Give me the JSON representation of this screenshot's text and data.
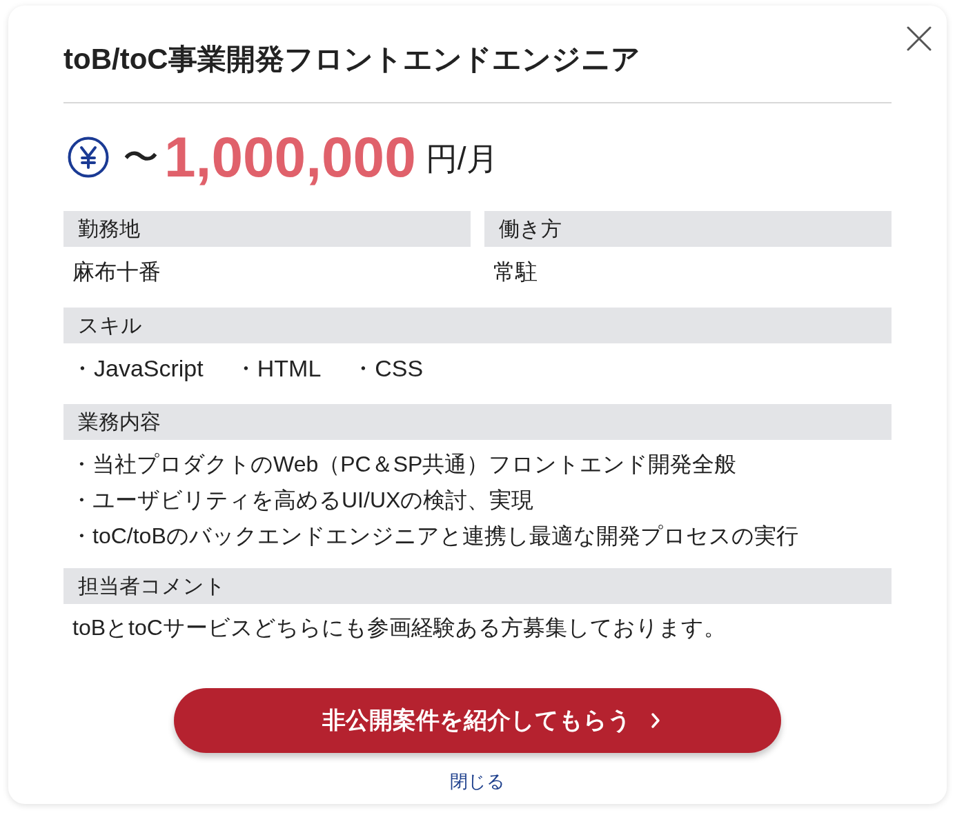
{
  "dialog": {
    "title": "toB/toC事業開発フロントエンドエンジニア"
  },
  "salary": {
    "prefix": "〜",
    "amount": "1,000,000",
    "unit": "円/月"
  },
  "info_grid": [
    {
      "heading": "勤務地",
      "value": "麻布十番"
    },
    {
      "heading": "働き方",
      "value": "常駐"
    }
  ],
  "skills": {
    "heading": "スキル",
    "items": [
      "・JavaScript",
      "・HTML",
      "・CSS"
    ]
  },
  "duties": {
    "heading": "業務内容",
    "lines": [
      "・当社プロダクトのWeb（PC＆SP共通）フロントエンド開発全般",
      "・ユーザビリティを高めるUI/UXの検討、実現",
      "・toC/toBのバックエンドエンジニアと連携し最適な開発プロセスの実行"
    ]
  },
  "comment": {
    "heading": "担当者コメント",
    "text": "toBとtoCサービスどちらにも参画経験ある方募集しております。"
  },
  "cta_button": {
    "label": "非公開案件を紹介してもらう"
  },
  "close_link": {
    "label": "閉じる"
  }
}
